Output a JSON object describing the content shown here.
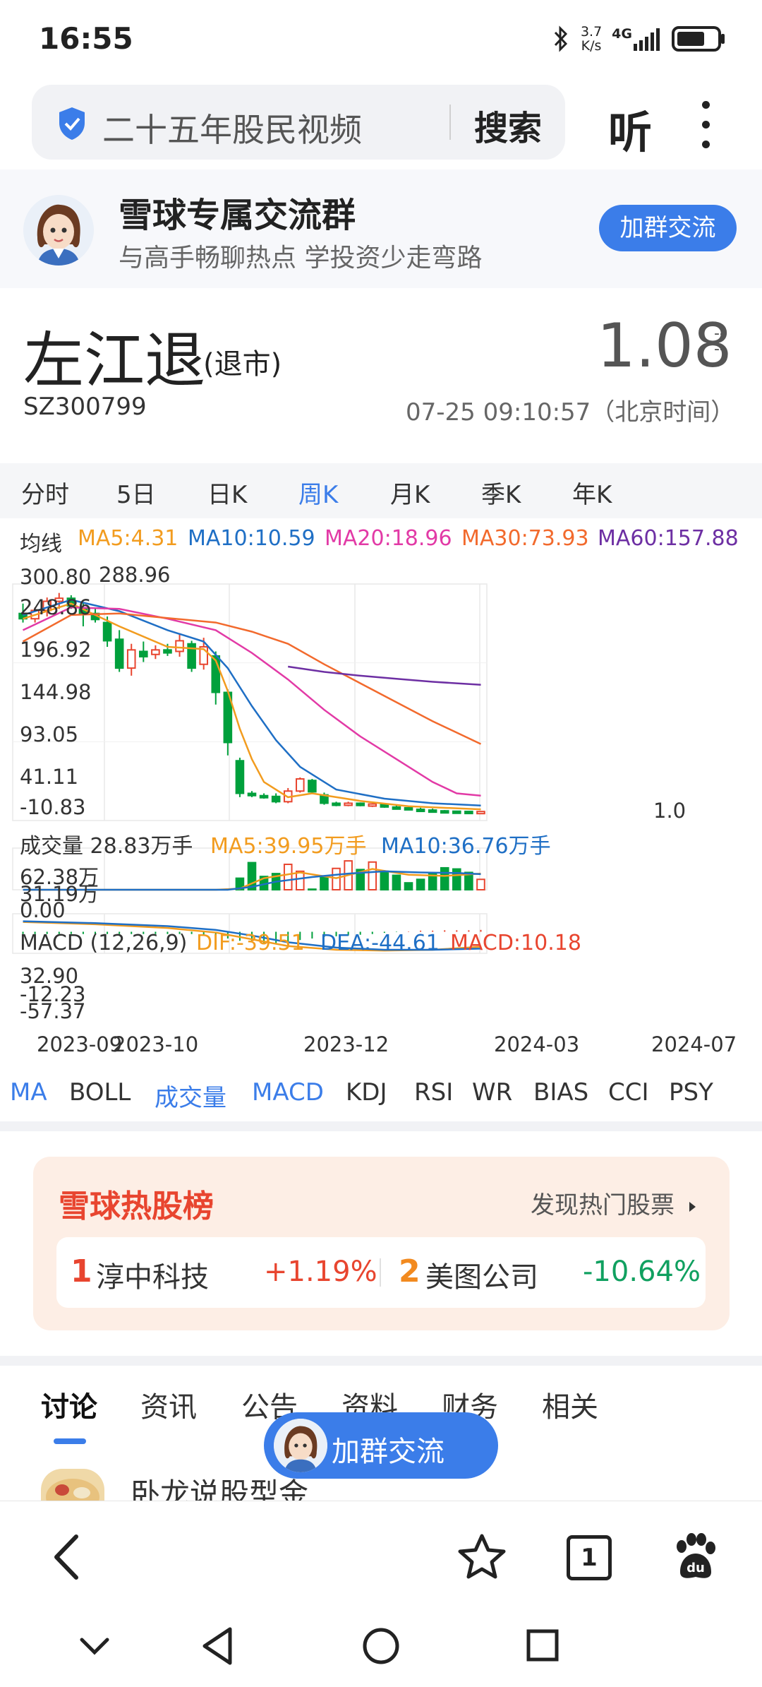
{
  "status_bar": {
    "time": "16:55",
    "net_speed_value": "3.7",
    "net_speed_unit": "K/s",
    "network": "4G",
    "icons": [
      "bluetooth-icon",
      "signal-icon",
      "battery-icon"
    ]
  },
  "search": {
    "query": "二十五年股民视频",
    "button": "搜索",
    "listen": "听",
    "icons": [
      "shield-icon",
      "more-vertical-icon"
    ]
  },
  "banner": {
    "title": "雪球专属交流群",
    "subtitle": "与高手畅聊热点 学投资少走弯路",
    "button": "加群交流"
  },
  "stock": {
    "name": "左江退",
    "tag": "(退市)",
    "code": "SZ300799",
    "price": "1.08",
    "change": "--",
    "change_pct": "--",
    "time": "07-25 09:10:57（北京时间）"
  },
  "period_tabs": {
    "items": [
      "分时",
      "5日",
      "日K",
      "周K",
      "月K",
      "季K",
      "年K"
    ],
    "active": "周K"
  },
  "ma_bar": {
    "label": "均线",
    "ma5": "MA5:4.31",
    "ma10": "MA10:10.59",
    "ma20": "MA20:18.96",
    "ma30": "MA30:73.93",
    "ma60": "MA60:157.88"
  },
  "colors": {
    "accent": "#3b7de9",
    "up": "#e8452f",
    "down": "#00a03c",
    "ma5": "#f29c1f",
    "ma10": "#1f6fc5",
    "ma20": "#e23aa6",
    "ma30": "#f26a2d",
    "ma60": "#6d2fa3",
    "hot_bg": "#fdeee5"
  },
  "chart_data": {
    "type": "candlestick",
    "price_axis": [
      "300.80",
      "248.86",
      "196.92",
      "144.98",
      "93.05",
      "41.11",
      "-10.83"
    ],
    "high_label": "288.96",
    "low_label": "1.0",
    "x_ticks": [
      "2023-09",
      "2023-10",
      "2023-12",
      "2024-03",
      "2024-07"
    ],
    "candles": [
      {
        "o": 262,
        "h": 275,
        "l": 250,
        "c": 255
      },
      {
        "o": 255,
        "h": 270,
        "l": 250,
        "c": 266
      },
      {
        "o": 266,
        "h": 283,
        "l": 258,
        "c": 278
      },
      {
        "o": 278,
        "h": 289,
        "l": 268,
        "c": 282
      },
      {
        "o": 282,
        "h": 286,
        "l": 268,
        "c": 272
      },
      {
        "o": 268,
        "h": 276,
        "l": 245,
        "c": 262
      },
      {
        "o": 262,
        "h": 270,
        "l": 250,
        "c": 254
      },
      {
        "o": 250,
        "h": 258,
        "l": 218,
        "c": 226
      },
      {
        "o": 228,
        "h": 240,
        "l": 185,
        "c": 190
      },
      {
        "o": 190,
        "h": 222,
        "l": 180,
        "c": 214
      },
      {
        "o": 212,
        "h": 225,
        "l": 198,
        "c": 205
      },
      {
        "o": 208,
        "h": 220,
        "l": 202,
        "c": 214
      },
      {
        "o": 214,
        "h": 222,
        "l": 206,
        "c": 210
      },
      {
        "o": 212,
        "h": 236,
        "l": 205,
        "c": 226
      },
      {
        "o": 222,
        "h": 226,
        "l": 185,
        "c": 190
      },
      {
        "o": 195,
        "h": 230,
        "l": 188,
        "c": 218
      },
      {
        "o": 206,
        "h": 212,
        "l": 142,
        "c": 158
      },
      {
        "o": 158,
        "h": 162,
        "l": 75,
        "c": 92
      },
      {
        "o": 68,
        "h": 72,
        "l": 20,
        "c": 25
      },
      {
        "o": 25,
        "h": 28,
        "l": 20,
        "c": 22
      },
      {
        "o": 22,
        "h": 25,
        "l": 18,
        "c": 21
      },
      {
        "o": 21,
        "h": 25,
        "l": 12,
        "c": 14
      },
      {
        "o": 14,
        "h": 32,
        "l": 12,
        "c": 28
      },
      {
        "o": 28,
        "h": 46,
        "l": 26,
        "c": 44
      },
      {
        "o": 42,
        "h": 44,
        "l": 24,
        "c": 27
      },
      {
        "o": 23,
        "h": 26,
        "l": 10,
        "c": 12
      },
      {
        "o": 12,
        "h": 14,
        "l": 8,
        "c": 10
      },
      {
        "o": 10,
        "h": 14,
        "l": 8,
        "c": 12
      },
      {
        "o": 12,
        "h": 13,
        "l": 8,
        "c": 9
      },
      {
        "o": 9,
        "h": 12,
        "l": 7,
        "c": 11
      },
      {
        "o": 11,
        "h": 12,
        "l": 6,
        "c": 7
      },
      {
        "o": 7,
        "h": 9,
        "l": 5,
        "c": 6
      },
      {
        "o": 6,
        "h": 7,
        "l": 3,
        "c": 4
      },
      {
        "o": 4,
        "h": 6,
        "l": 2,
        "c": 3
      },
      {
        "o": 3,
        "h": 5,
        "l": 1,
        "c": 2
      },
      {
        "o": 2,
        "h": 3,
        "l": 1,
        "c": 1.5
      },
      {
        "o": 1.5,
        "h": 2,
        "l": 1,
        "c": 1.2
      },
      {
        "o": 1.2,
        "h": 1.5,
        "l": 1,
        "c": 1.1
      },
      {
        "o": 1.0,
        "h": 1.3,
        "l": 0.9,
        "c": 1.08
      }
    ],
    "ma_series": {
      "ma5": [
        [
          0,
          255
        ],
        [
          4,
          275
        ],
        [
          8,
          245
        ],
        [
          12,
          218
        ],
        [
          15,
          215
        ],
        [
          16,
          200
        ],
        [
          17,
          160
        ],
        [
          18,
          110
        ],
        [
          19,
          70
        ],
        [
          20,
          40
        ],
        [
          22,
          20
        ],
        [
          24,
          25
        ],
        [
          28,
          15
        ],
        [
          32,
          8
        ],
        [
          38,
          4
        ]
      ],
      "ma10": [
        [
          0,
          260
        ],
        [
          4,
          280
        ],
        [
          8,
          265
        ],
        [
          12,
          240
        ],
        [
          15,
          225
        ],
        [
          17,
          190
        ],
        [
          19,
          140
        ],
        [
          21,
          95
        ],
        [
          23,
          60
        ],
        [
          26,
          30
        ],
        [
          30,
          18
        ],
        [
          34,
          12
        ],
        [
          38,
          9
        ]
      ],
      "ma20": [
        [
          0,
          240
        ],
        [
          4,
          270
        ],
        [
          8,
          268
        ],
        [
          12,
          255
        ],
        [
          16,
          240
        ],
        [
          19,
          210
        ],
        [
          22,
          175
        ],
        [
          25,
          135
        ],
        [
          28,
          100
        ],
        [
          31,
          70
        ],
        [
          34,
          40
        ],
        [
          36,
          25
        ],
        [
          38,
          22
        ]
      ],
      "ma30": [
        [
          0,
          225
        ],
        [
          4,
          260
        ],
        [
          8,
          262
        ],
        [
          12,
          256
        ],
        [
          16,
          250
        ],
        [
          19,
          238
        ],
        [
          22,
          222
        ],
        [
          25,
          195
        ],
        [
          28,
          170
        ],
        [
          31,
          145
        ],
        [
          34,
          120
        ],
        [
          38,
          90
        ]
      ],
      "ma60": [
        [
          22,
          192
        ],
        [
          25,
          185
        ],
        [
          28,
          180
        ],
        [
          31,
          176
        ],
        [
          34,
          172
        ],
        [
          38,
          168
        ]
      ]
    },
    "volume": {
      "axis": [
        "62.38万",
        "31.19万",
        "0.00"
      ],
      "label": "成交量 28.83万手",
      "ma5": "MA5:39.95万手",
      "ma10": "MA10:36.76万手",
      "values": [
        0,
        0,
        0,
        0,
        0,
        0,
        0,
        0,
        0,
        0,
        0,
        0,
        0,
        0,
        0,
        0,
        0,
        0,
        20,
        47,
        23,
        28,
        44,
        32,
        1,
        22,
        37,
        50,
        35,
        48,
        32,
        25,
        12,
        18,
        28,
        38,
        36,
        30,
        18
      ],
      "up": [
        false,
        true,
        false,
        false,
        false,
        false,
        false,
        false,
        false,
        true,
        false,
        true,
        false,
        true,
        false,
        true,
        false,
        false,
        false,
        false,
        false,
        false,
        true,
        true,
        false,
        false,
        true,
        true,
        false,
        true,
        false,
        false,
        false,
        false,
        false,
        false,
        false,
        false,
        true
      ]
    },
    "macd": {
      "label": "MACD (12,26,9)",
      "dif": "DIF:-39.51",
      "dea": "DEA:-44.61",
      "macd": "MACD:10.18",
      "axis": [
        "32.90",
        "-12.23",
        "-57.37"
      ]
    }
  },
  "indicator_tabs": {
    "items": [
      "MA",
      "BOLL",
      "成交量",
      "MACD",
      "KDJ",
      "RSI",
      "WR",
      "BIAS",
      "CCI",
      "PSY"
    ],
    "active": [
      "MA",
      "成交量",
      "MACD"
    ]
  },
  "hot_list": {
    "title": "雪球热股榜",
    "more": "发现热门股票",
    "items": [
      {
        "rank": "1",
        "name": "淳中科技",
        "change": "+1.19%"
      },
      {
        "rank": "2",
        "name": "美图公司",
        "change": "-10.64%"
      }
    ]
  },
  "discussion_tabs": {
    "items": [
      "讨论",
      "资讯",
      "公告",
      "资料",
      "财务",
      "相关"
    ],
    "active": "讨论"
  },
  "post_preview": {
    "author": "卧龙说股型金"
  },
  "float_button": {
    "label": "加群交流"
  },
  "bottom_nav": {
    "page_count": "1",
    "icons": [
      "back-arrow-icon",
      "star-icon",
      "tabs-icon",
      "paw-icon"
    ]
  },
  "system_nav": {
    "icons": [
      "chevron-down-icon",
      "back-triangle-icon",
      "home-circle-icon",
      "recent-square-icon"
    ]
  }
}
